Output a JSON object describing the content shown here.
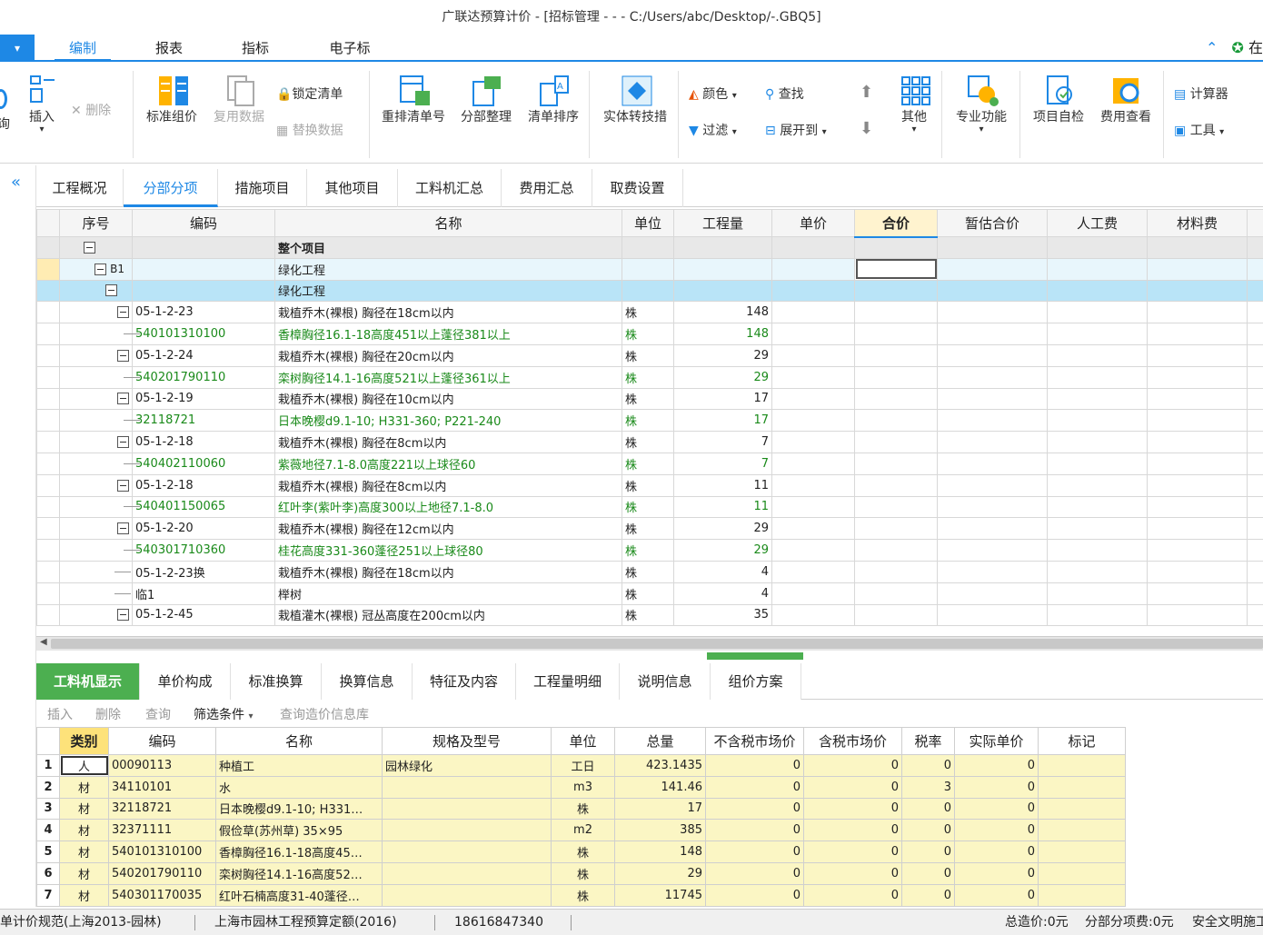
{
  "window": {
    "title": "广联达预算计价 - [招标管理 - - - C:/Users/abc/Desktop/-.GBQ5]"
  },
  "menu": {
    "file_label": "▾",
    "tabs": [
      {
        "label": "编制",
        "active": true
      },
      {
        "label": "报表"
      },
      {
        "label": "指标"
      },
      {
        "label": "电子标"
      }
    ],
    "right_label": "在"
  },
  "ribbon": {
    "partial_left": "询",
    "insert": "插入",
    "delete": "删除",
    "standard_group": "标准组价",
    "reuse_data": "复用数据",
    "lock_list": "锁定清单",
    "replace_data": "替换数据",
    "renumber": "重排清单号",
    "section_arrange": "分部整理",
    "list_sort": "清单排序",
    "entity_convert": "实体转技措",
    "color": "颜色",
    "find": "查找",
    "filter": "过滤",
    "expand_to": "展开到",
    "other": "其他",
    "pro_func": "专业功能",
    "self_check": "项目自检",
    "fee_view": "费用查看",
    "calculator": "计算器",
    "tools": "工具"
  },
  "subtabs": [
    {
      "label": "工程概况"
    },
    {
      "label": "分部分项",
      "active": true
    },
    {
      "label": "措施项目"
    },
    {
      "label": "其他项目"
    },
    {
      "label": "工料机汇总"
    },
    {
      "label": "费用汇总"
    },
    {
      "label": "取费设置"
    }
  ],
  "grid": {
    "headers": [
      "序号",
      "编码",
      "名称",
      "单位",
      "工程量",
      "单价",
      "合价",
      "暂估合价",
      "人工费",
      "材料费"
    ],
    "rows": [
      {
        "kind": "lvl0",
        "seq": "",
        "code": "",
        "name": "整个项目",
        "unit": "",
        "qty": ""
      },
      {
        "kind": "lvl1",
        "seq": "B1",
        "code": "",
        "name": "绿化工程",
        "unit": "",
        "qty": ""
      },
      {
        "kind": "lvl2",
        "seq": "",
        "code": "",
        "name": "绿化工程",
        "unit": "",
        "qty": ""
      },
      {
        "kind": "main",
        "seq": "",
        "code": "05-1-2-23",
        "name": "栽植乔木(裸根) 胸径在18cm以内",
        "unit": "株",
        "qty": "148"
      },
      {
        "kind": "sub",
        "seq": "",
        "code": "540101310100",
        "name": "香樟胸径16.1-18高度451以上蓬径381以上",
        "unit": "株",
        "qty": "148"
      },
      {
        "kind": "main",
        "seq": "",
        "code": "05-1-2-24",
        "name": "栽植乔木(裸根) 胸径在20cm以内",
        "unit": "株",
        "qty": "29"
      },
      {
        "kind": "sub",
        "seq": "",
        "code": "540201790110",
        "name": "栾树胸径14.1-16高度521以上蓬径361以上",
        "unit": "株",
        "qty": "29"
      },
      {
        "kind": "main",
        "seq": "",
        "code": "05-1-2-19",
        "name": "栽植乔木(裸根) 胸径在10cm以内",
        "unit": "株",
        "qty": "17"
      },
      {
        "kind": "sub",
        "seq": "",
        "code": "32118721",
        "name": "日本晚樱d9.1-10; H331-360; P221-240",
        "unit": "株",
        "qty": "17"
      },
      {
        "kind": "main",
        "seq": "",
        "code": "05-1-2-18",
        "name": "栽植乔木(裸根) 胸径在8cm以内",
        "unit": "株",
        "qty": "7"
      },
      {
        "kind": "sub",
        "seq": "",
        "code": "540402110060",
        "name": "紫薇地径7.1-8.0高度221以上球径60",
        "unit": "株",
        "qty": "7"
      },
      {
        "kind": "main",
        "seq": "",
        "code": "05-1-2-18",
        "name": "栽植乔木(裸根) 胸径在8cm以内",
        "unit": "株",
        "qty": "11"
      },
      {
        "kind": "sub",
        "seq": "",
        "code": "540401150065",
        "name": "红叶李(紫叶李)高度300以上地径7.1-8.0",
        "unit": "株",
        "qty": "11"
      },
      {
        "kind": "main",
        "seq": "",
        "code": "05-1-2-20",
        "name": "栽植乔木(裸根) 胸径在12cm以内",
        "unit": "株",
        "qty": "29"
      },
      {
        "kind": "sub",
        "seq": "",
        "code": "540301710360",
        "name": "桂花高度331-360蓬径251以上球径80",
        "unit": "株",
        "qty": "29"
      },
      {
        "kind": "mainleaf",
        "seq": "",
        "code": "05-1-2-23换",
        "name": "栽植乔木(裸根) 胸径在18cm以内",
        "unit": "株",
        "qty": "4"
      },
      {
        "kind": "mainleaf",
        "seq": "",
        "code": "临1",
        "name": "榉树",
        "unit": "株",
        "qty": "4"
      },
      {
        "kind": "main",
        "seq": "",
        "code": "05-1-2-45",
        "name": "栽植灌木(裸根) 冠丛高度在200cm以内",
        "unit": "株",
        "qty": "35"
      }
    ]
  },
  "bottom_tabs": [
    {
      "label": "工料机显示",
      "active": true
    },
    {
      "label": "单价构成"
    },
    {
      "label": "标准换算"
    },
    {
      "label": "换算信息"
    },
    {
      "label": "特征及内容"
    },
    {
      "label": "工程量明细"
    },
    {
      "label": "说明信息"
    },
    {
      "label": "组价方案"
    }
  ],
  "bottom_toolbar": {
    "insert": "插入",
    "delete": "删除",
    "query": "查询",
    "filter": "筛选条件",
    "query_price": "查询造价信息库"
  },
  "bgrid": {
    "headers": [
      "",
      "类别",
      "编码",
      "名称",
      "规格及型号",
      "单位",
      "总量",
      "不含税市场价",
      "含税市场价",
      "税率",
      "实际单价",
      "标记"
    ],
    "rows": [
      {
        "n": "1",
        "type": "人",
        "code": "00090113",
        "name": "种植工",
        "spec": "园林绿化",
        "unit": "工日",
        "total": "423.1435",
        "p1": "0",
        "p2": "0",
        "tax": "0",
        "price": "0"
      },
      {
        "n": "2",
        "type": "材",
        "code": "34110101",
        "name": "水",
        "spec": "",
        "unit": "m3",
        "total": "141.46",
        "p1": "0",
        "p2": "0",
        "tax": "3",
        "price": "0"
      },
      {
        "n": "3",
        "type": "材",
        "code": "32118721",
        "name": "日本晚樱d9.1-10; H331…",
        "spec": "",
        "unit": "株",
        "total": "17",
        "p1": "0",
        "p2": "0",
        "tax": "0",
        "price": "0"
      },
      {
        "n": "4",
        "type": "材",
        "code": "32371111",
        "name": "假俭草(苏州草) 35×95",
        "spec": "",
        "unit": "m2",
        "total": "385",
        "p1": "0",
        "p2": "0",
        "tax": "0",
        "price": "0"
      },
      {
        "n": "5",
        "type": "材",
        "code": "540101310100",
        "name": "香樟胸径16.1-18高度45…",
        "spec": "",
        "unit": "株",
        "total": "148",
        "p1": "0",
        "p2": "0",
        "tax": "0",
        "price": "0"
      },
      {
        "n": "6",
        "type": "材",
        "code": "540201790110",
        "name": "栾树胸径14.1-16高度52…",
        "spec": "",
        "unit": "株",
        "total": "29",
        "p1": "0",
        "p2": "0",
        "tax": "0",
        "price": "0"
      },
      {
        "n": "7",
        "type": "材",
        "code": "540301170035",
        "name": "红叶石楠高度31-40蓬径…",
        "spec": "",
        "unit": "株",
        "total": "11745",
        "p1": "0",
        "p2": "0",
        "tax": "0",
        "price": "0"
      }
    ]
  },
  "status": {
    "norm": "单计价规范(上海2013-园林)",
    "quota": "上海市园林工程预算定额(2016)",
    "phone": "18616847340",
    "total": "总造价:0元",
    "section_fee": "分部分项费:0元",
    "safety": "安全文明施工"
  },
  "colors": {
    "accent": "#1e88e5",
    "green_tab": "#4caf50",
    "sub_text": "#1a8a1a"
  }
}
